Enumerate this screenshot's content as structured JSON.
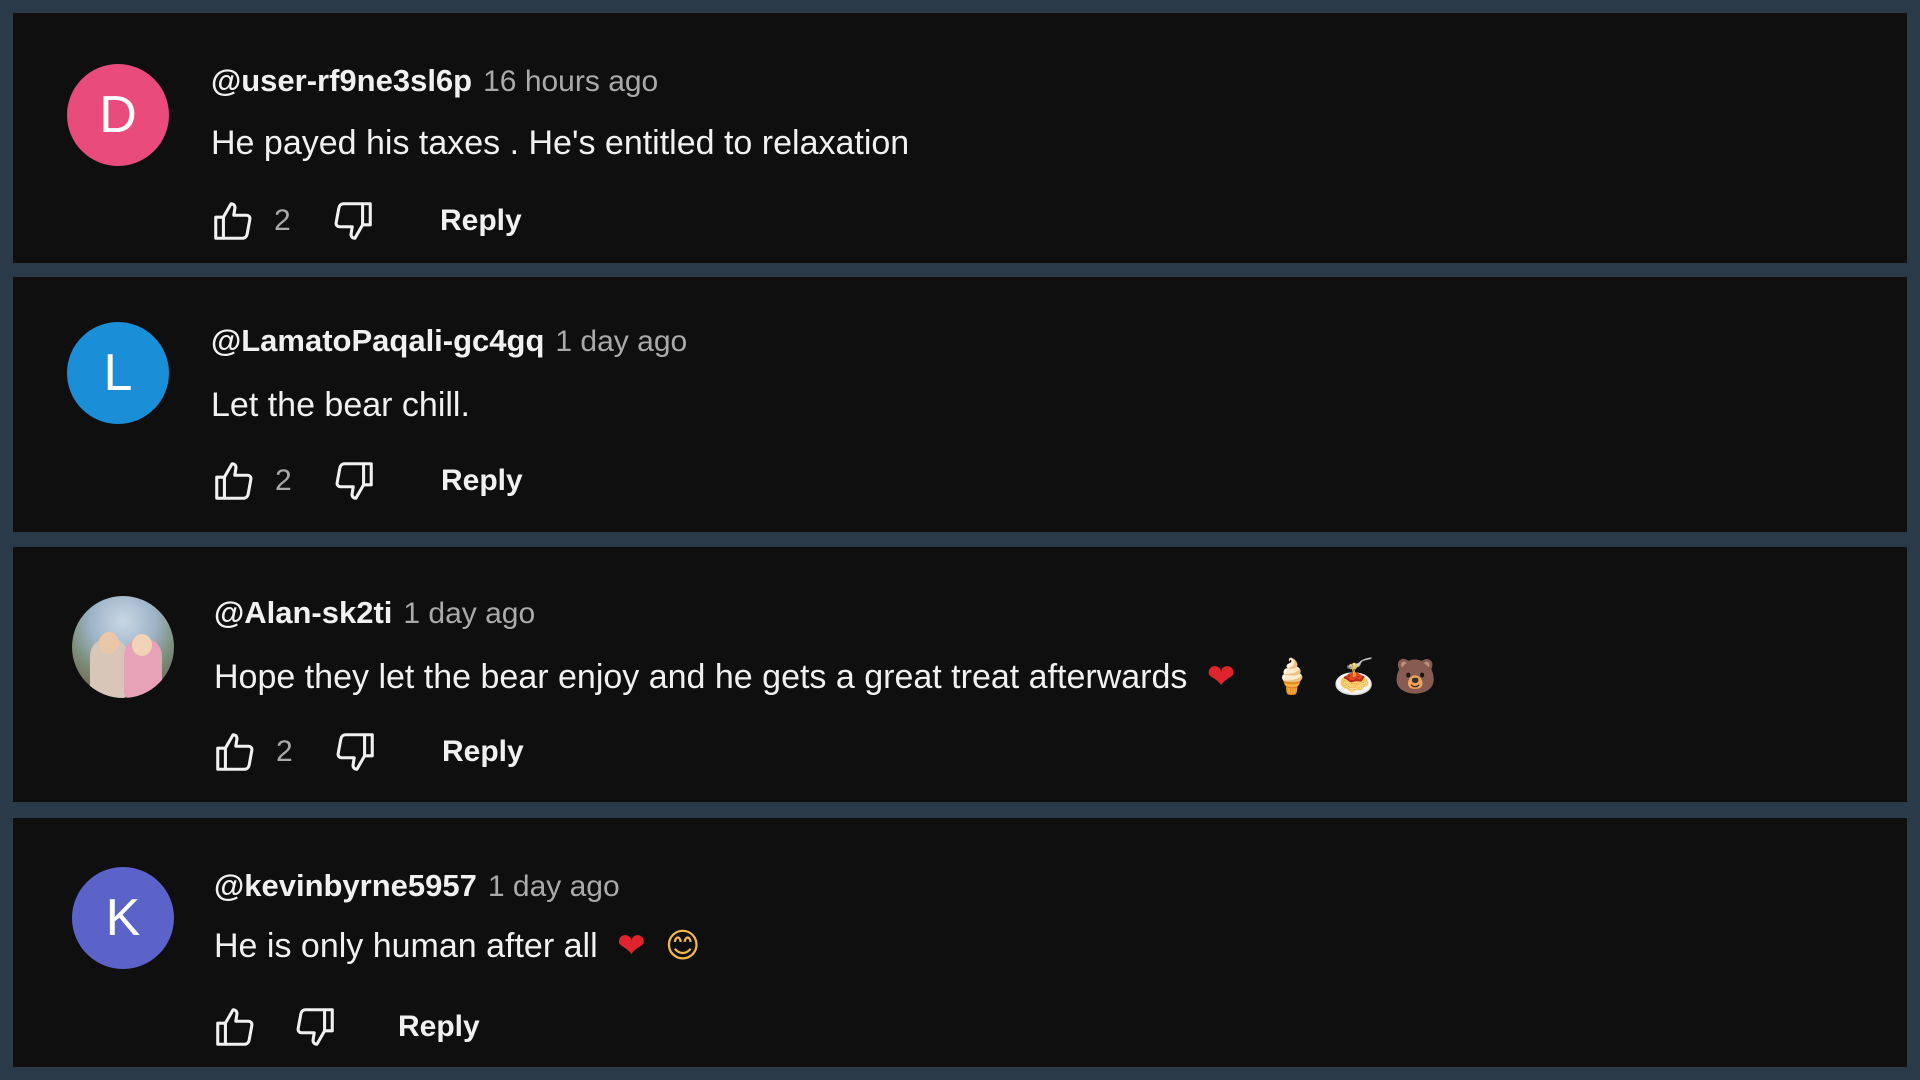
{
  "comments": [
    {
      "avatar_letter": "D",
      "avatar_color": "#e94b7d",
      "handle": "@user-rf9ne3sl6p",
      "time": "16 hours ago",
      "text": "He payed his taxes . He's entitled to relaxation",
      "emojis": [],
      "likes": "2",
      "reply_label": "Reply"
    },
    {
      "avatar_letter": "L",
      "avatar_color": "#1a8fd8",
      "handle": "@LamatoPaqali-gc4gq",
      "time": "1 day ago",
      "text": "Let the bear chill.",
      "emojis": [],
      "likes": "2",
      "reply_label": "Reply"
    },
    {
      "avatar_letter": "",
      "avatar_color": "",
      "handle": "@Alan-sk2ti",
      "time": "1 day ago",
      "text": "Hope they let the bear enjoy and he gets a great treat afterwards",
      "emojis": [
        "❤",
        "🍦",
        "🍝",
        "🐻"
      ],
      "likes": "2",
      "reply_label": "Reply"
    },
    {
      "avatar_letter": "K",
      "avatar_color": "#5b63c9",
      "handle": "@kevinbyrne5957",
      "time": "1 day ago",
      "text": "He is only human after all",
      "emojis": [
        "❤",
        "😊"
      ],
      "likes": "",
      "reply_label": "Reply"
    }
  ],
  "colors": {
    "background_frame": "#2b3a48",
    "card": "#0f0f10",
    "text_primary": "#f1f1f1",
    "text_secondary": "#aaaaaa"
  },
  "icons": {
    "like": "thumbs-up-icon",
    "dislike": "thumbs-down-icon"
  }
}
